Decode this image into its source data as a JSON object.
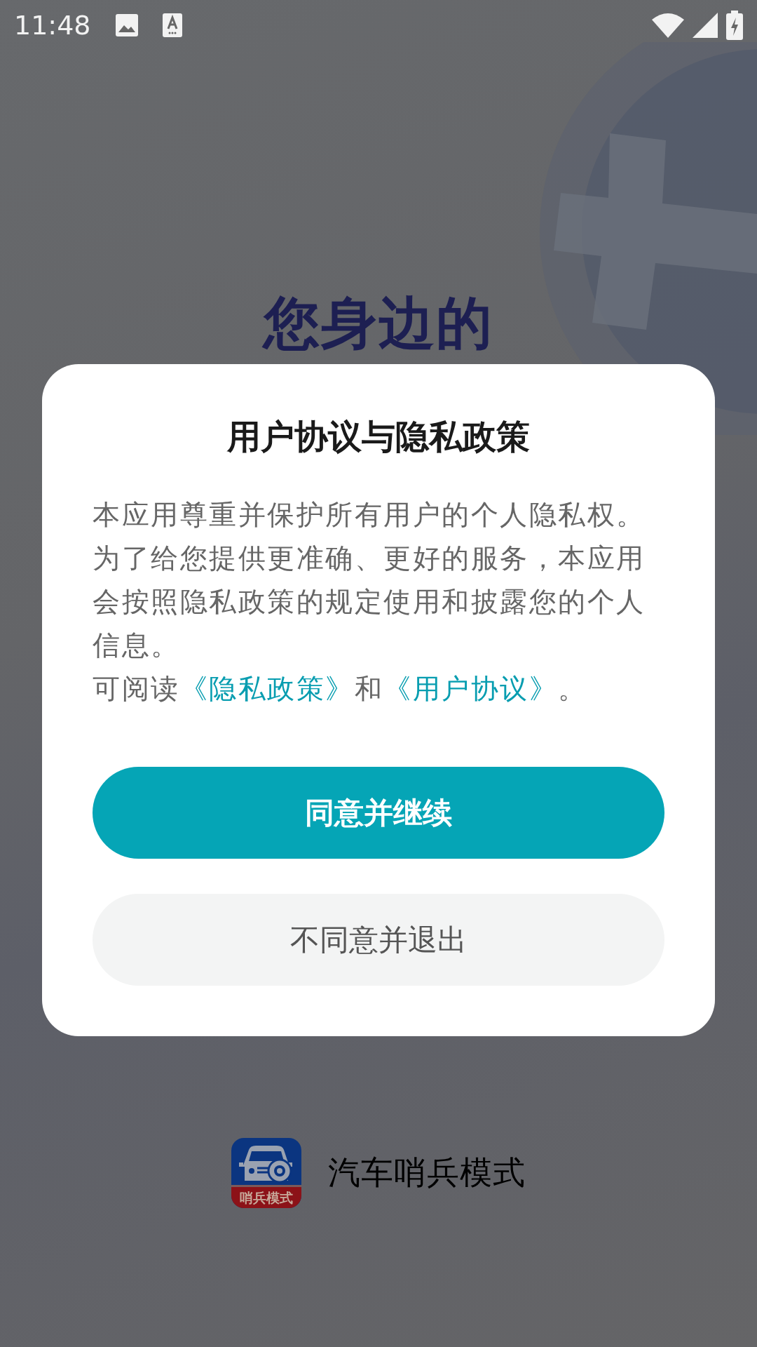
{
  "status_bar": {
    "time": "11:48"
  },
  "headline": "您身边的",
  "dialog": {
    "title": "用户协议与隐私政策",
    "notice": "本应用尊重并保护所有用户的个人隐私权。为了给您提供更准确、更好的服务，本应用会按照隐私政策的规定使用和披露您的个人信息。",
    "read_line": [
      {
        "kind": "text",
        "text": "可阅读"
      },
      {
        "kind": "link",
        "text": "《隐私政策》"
      },
      {
        "kind": "text",
        "text": "和"
      },
      {
        "kind": "link",
        "text": "《用户协议》"
      },
      {
        "kind": "text",
        "text": "。"
      }
    ],
    "buttons": [
      {
        "kind": "primary",
        "label": "同意并继续"
      },
      {
        "kind": "secondary",
        "label": "不同意并退出"
      }
    ]
  },
  "brand": {
    "icon_caption": "哨兵模式",
    "name": "汽车哨兵模式"
  }
}
